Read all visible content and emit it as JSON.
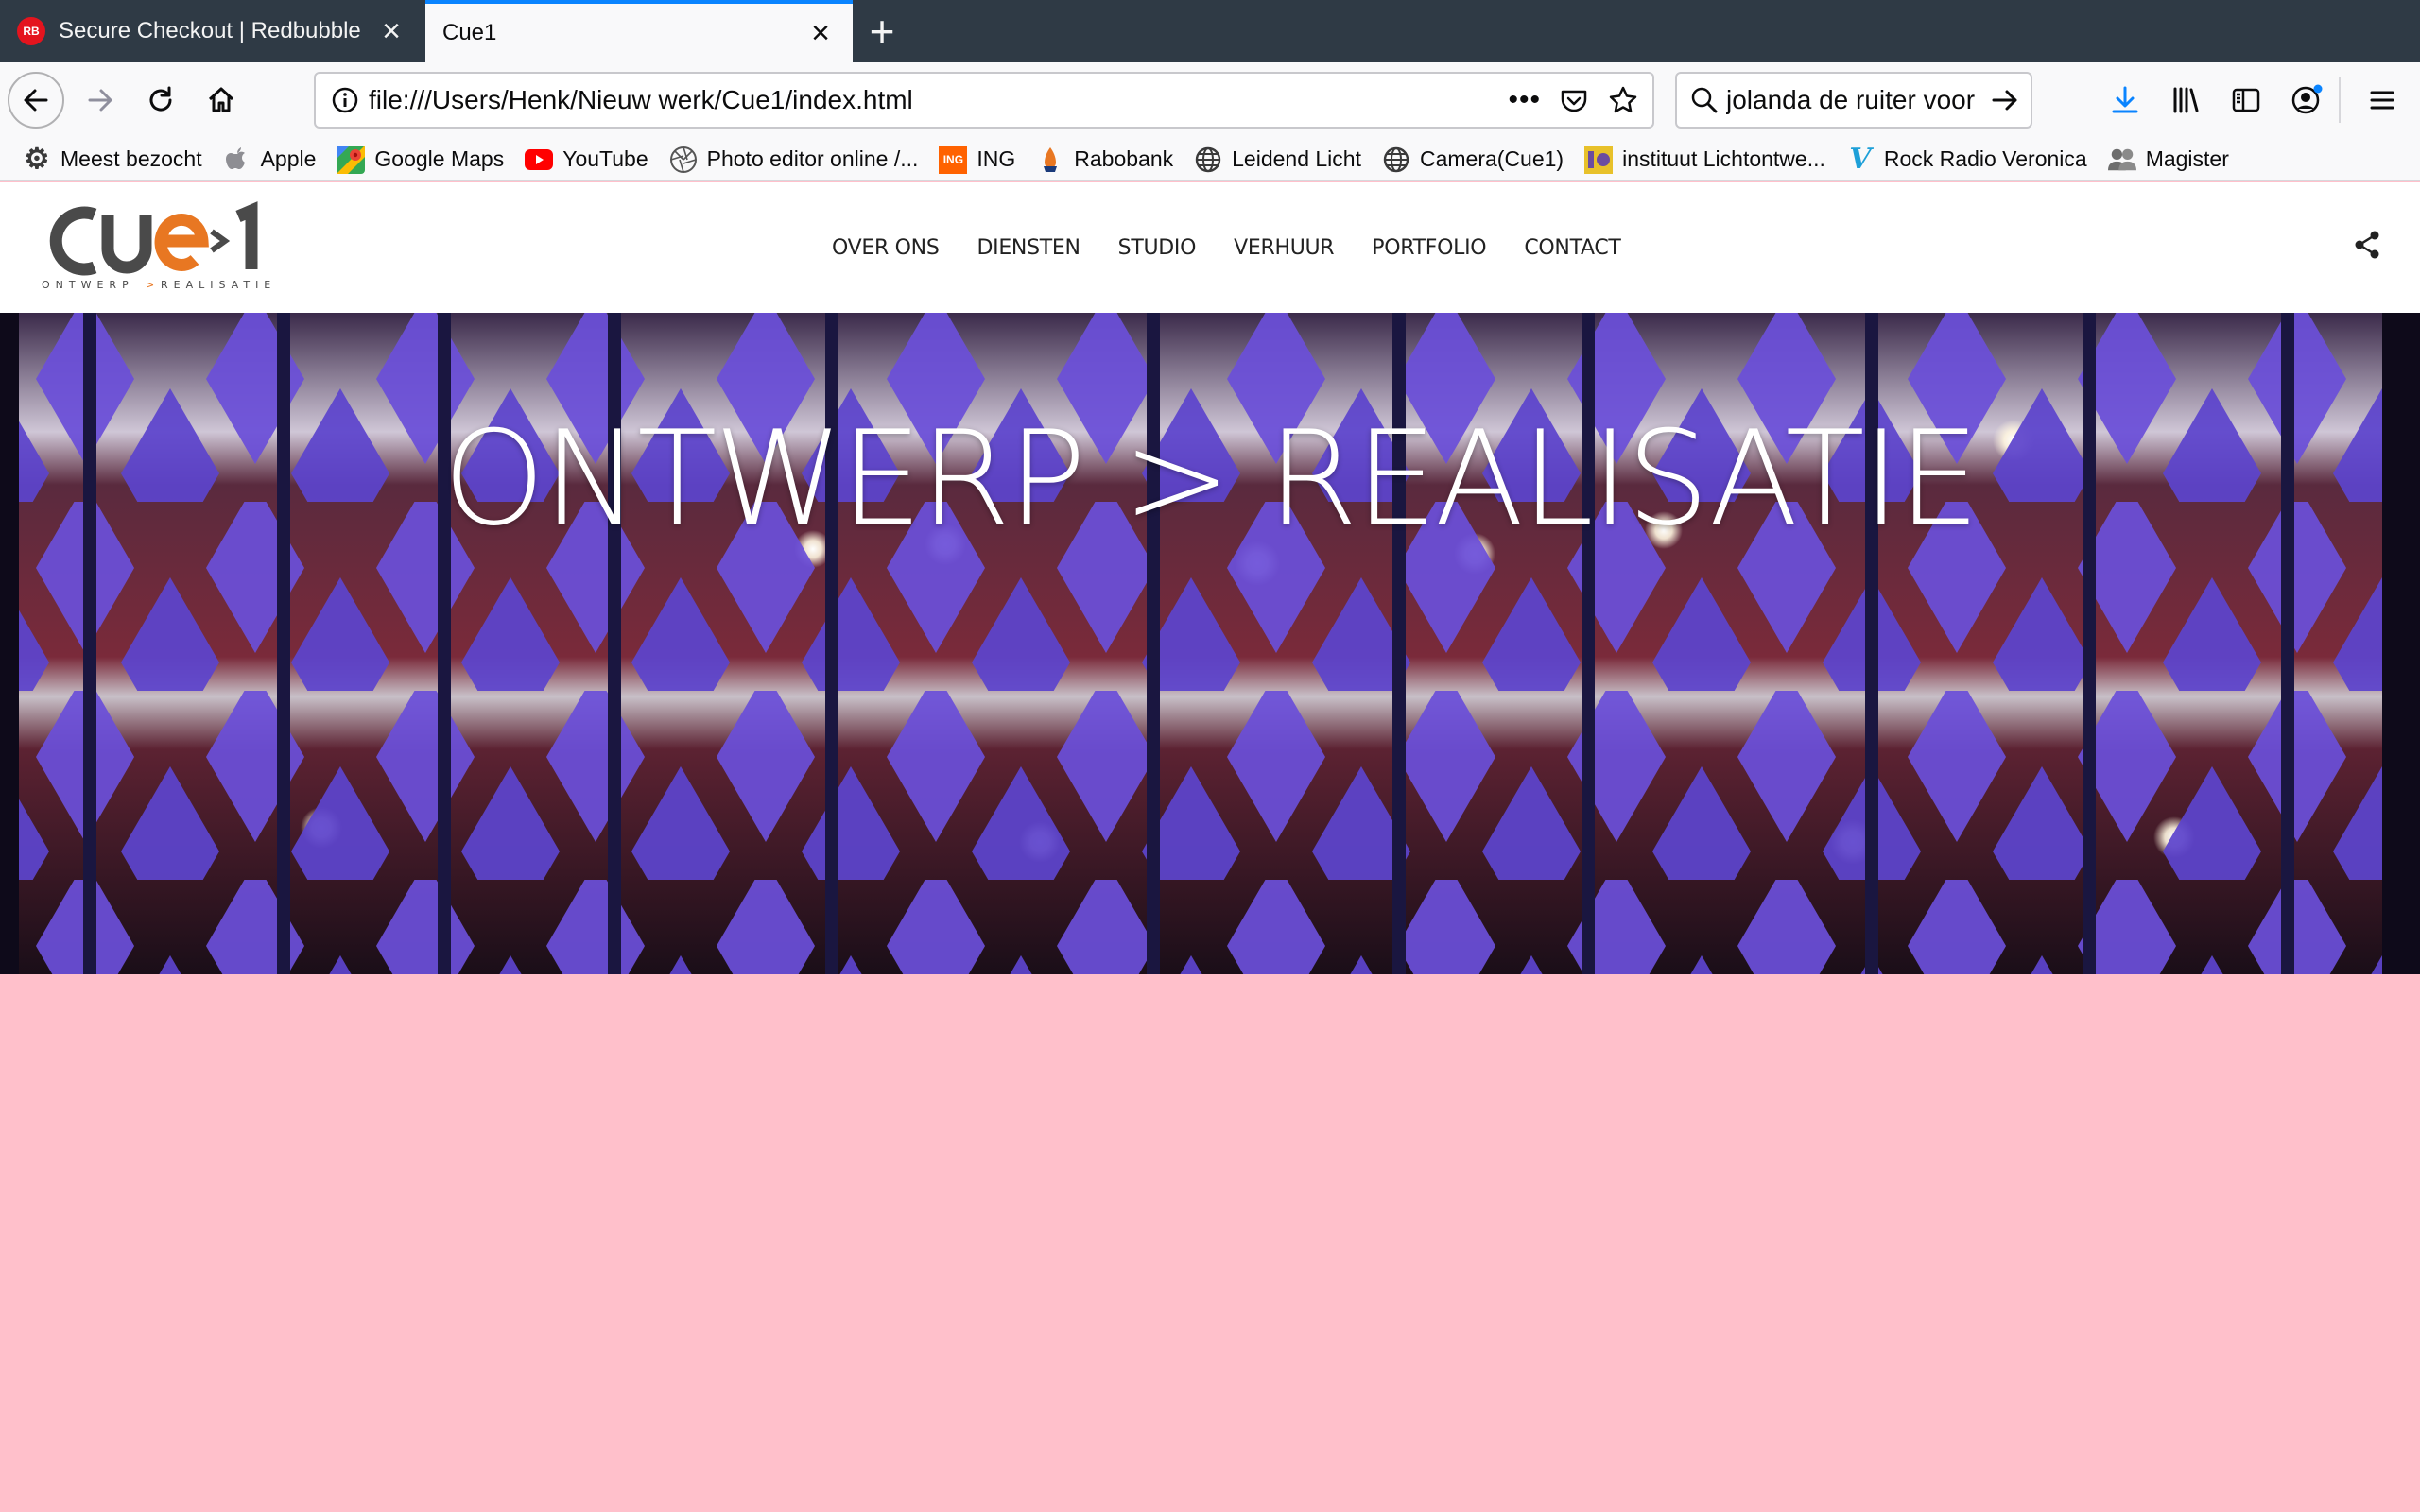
{
  "browser": {
    "tabs": [
      {
        "title": "Secure Checkout | Redbubble",
        "favicon": "RB",
        "active": false
      },
      {
        "title": "Cue1",
        "favicon": "",
        "active": true
      }
    ],
    "url": "file:///Users/Henk/Nieuw werk/Cue1/index.html",
    "search_text": "jolanda de ruiter voor",
    "bookmarks": [
      {
        "label": "Meest bezocht",
        "icon": "gear-icon"
      },
      {
        "label": "Apple",
        "icon": "apple-icon"
      },
      {
        "label": "Google Maps",
        "icon": "maps-icon"
      },
      {
        "label": "YouTube",
        "icon": "youtube-icon"
      },
      {
        "label": "Photo editor online /...",
        "icon": "aperture-icon"
      },
      {
        "label": "ING",
        "icon": "ing-icon"
      },
      {
        "label": "Rabobank",
        "icon": "rabobank-icon"
      },
      {
        "label": "Leidend Licht",
        "icon": "globe-icon"
      },
      {
        "label": "Camera(Cue1)",
        "icon": "globe-icon"
      },
      {
        "label": "instituut Lichtontwe...",
        "icon": "ilo-icon"
      },
      {
        "label": "Rock Radio Veronica",
        "icon": "veronica-icon"
      },
      {
        "label": "Magister",
        "icon": "people-icon"
      }
    ]
  },
  "site": {
    "logo": {
      "text": "CUe1",
      "tagline": "ONTWERP > REALISATIE",
      "accent": "#e87722",
      "dark": "#4a4a4a"
    },
    "nav": [
      "OVER ONS",
      "DIENSTEN",
      "STUDIO",
      "VERHUUR",
      "PORTFOLIO",
      "CONTACT"
    ],
    "hero_title": "ONTWERP > REALISATIE",
    "page_background": "#ffc0cb"
  }
}
